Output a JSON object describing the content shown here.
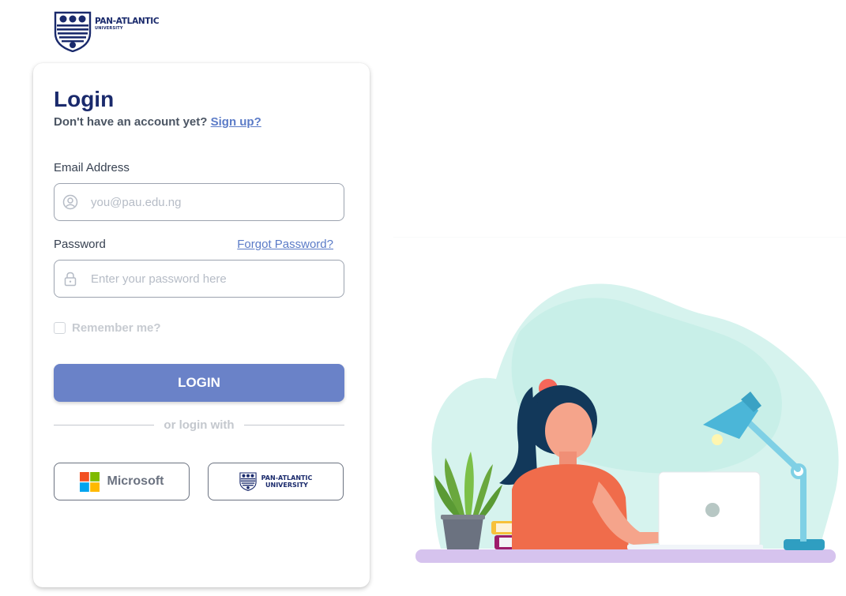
{
  "logo": {
    "name": "PAN-ATLANTIC",
    "sub": "UNIVERSITY"
  },
  "login": {
    "title": "Login",
    "no_account_text": "Don't have an account yet?",
    "signup_link": "Sign up?",
    "email_label": "Email Address",
    "email_placeholder": "you@pau.edu.ng",
    "password_label": "Password",
    "forgot_link": "Forgot Password?",
    "password_placeholder": "Enter your password here",
    "remember_label": "Remember me?",
    "login_button": "LOGIN",
    "divider_text": "or login with",
    "microsoft_label": "Microsoft",
    "pau_label": "PAN-ATLANTIC\nUNIVERSITY"
  },
  "colors": {
    "brand_navy": "#1a2a6c",
    "accent_blue": "#6a82c8",
    "link_blue": "#5b7bc7"
  },
  "icons": [
    "user-circle-icon",
    "lock-icon",
    "microsoft-logo-icon",
    "pau-crest-icon"
  ]
}
